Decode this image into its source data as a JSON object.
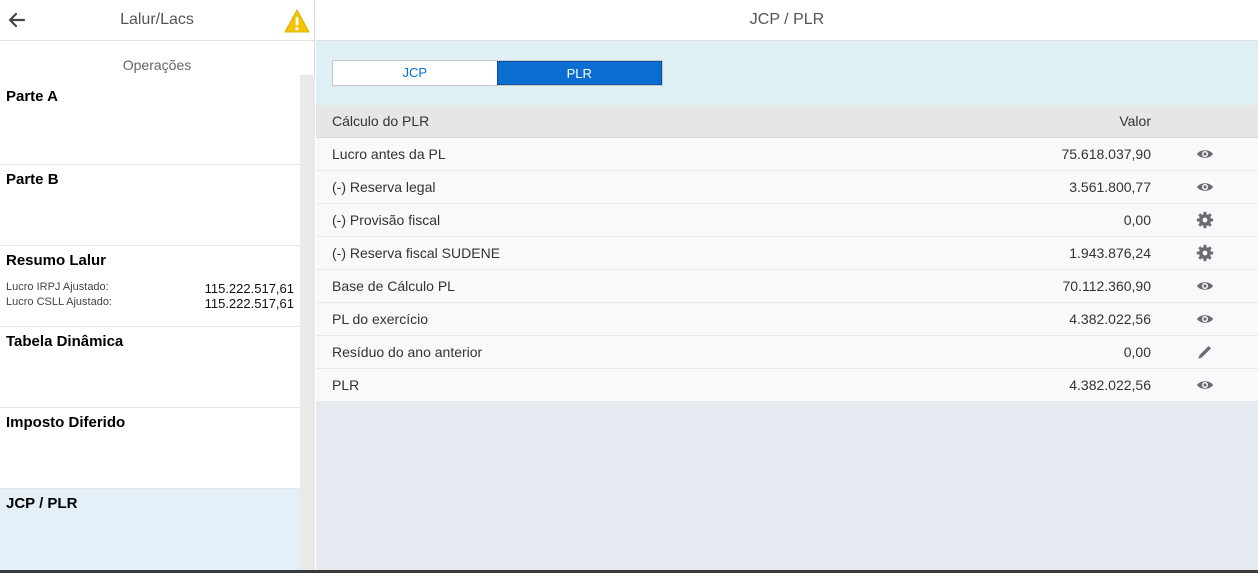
{
  "left": {
    "title": "Lalur/Lacs",
    "section": "Operações",
    "items": [
      {
        "label": "Parte A"
      },
      {
        "label": "Parte B"
      },
      {
        "label": "Resumo Lalur",
        "details": [
          {
            "label": "Lucro IRPJ Ajustado:",
            "value": "115.222.517,61"
          },
          {
            "label": "Lucro CSLL Ajustado:",
            "value": "115.222.517,61"
          }
        ]
      },
      {
        "label": "Tabela Dinâmica"
      },
      {
        "label": "Imposto Diferido"
      },
      {
        "label": "JCP / PLR"
      }
    ]
  },
  "right": {
    "title": "JCP / PLR",
    "segments": [
      {
        "label": "JCP",
        "selected": false
      },
      {
        "label": "PLR",
        "selected": true
      }
    ],
    "table": {
      "headers": {
        "label": "Cálculo do PLR",
        "value": "Valor"
      },
      "rows": [
        {
          "label": "Lucro antes da PL",
          "value": "75.618.037,90",
          "icon": "eye-icon"
        },
        {
          "label": "(-) Reserva legal",
          "value": "3.561.800,77",
          "icon": "eye-icon"
        },
        {
          "label": "(-) Provisão fiscal",
          "value": "0,00",
          "icon": "gear-icon"
        },
        {
          "label": "(-) Reserva fiscal SUDENE",
          "value": "1.943.876,24",
          "icon": "gear-icon"
        },
        {
          "label": "Base de Cálculo PL",
          "value": "70.112.360,90",
          "icon": "eye-icon"
        },
        {
          "label": "PL do exercício",
          "value": "4.382.022,56",
          "icon": "eye-icon"
        },
        {
          "label": "Resíduo do ano anterior",
          "value": "0,00",
          "icon": "pencil-icon"
        },
        {
          "label": "PLR",
          "value": "4.382.022,56",
          "icon": "eye-icon"
        }
      ]
    }
  },
  "colors": {
    "accent": "#0a6ed1",
    "warning": "#f5c400",
    "active_nav": "#e4eff8"
  }
}
